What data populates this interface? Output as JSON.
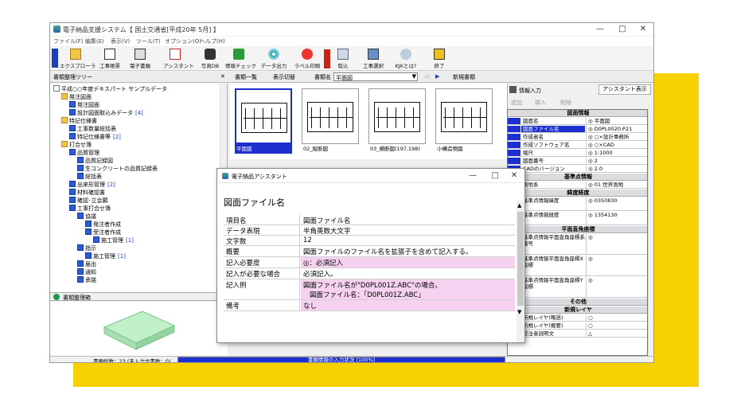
{
  "colors": {
    "accent": "#1c2fcf",
    "highlight": "#f7d1f0",
    "banner": "#f7d100"
  },
  "window": {
    "title": "電子納品支援システム【 国土交通省[平成20年 5月] 】",
    "minimize": "—",
    "maximize": "□",
    "close": "✕"
  },
  "menu": [
    "ファイル(F)",
    "編集(E)",
    "表示(V)",
    "ツール(T)",
    "オプション(O)",
    "ヘルプ(H)"
  ],
  "toolbar": [
    {
      "label": "エクスプローラ",
      "icon": "explorer-icon"
    },
    {
      "label": "工事帳票",
      "icon": "form-icon"
    },
    {
      "label": "電子書類",
      "icon": "document-icon"
    },
    {
      "label": "アシスタント",
      "icon": "assistant-icon"
    },
    {
      "label": "写真DB",
      "icon": "camera-icon"
    },
    {
      "label": "情報チェック",
      "icon": "check-icon"
    },
    {
      "label": "データ出力",
      "icon": "disc-icon"
    },
    {
      "label": "ラベル印刷",
      "icon": "label-icon"
    },
    {
      "label": "取込",
      "icon": "import-icon"
    },
    {
      "label": "工事選択",
      "icon": "select-icon"
    },
    {
      "label": "KJKとは?",
      "icon": "help-icon"
    },
    {
      "label": "終了",
      "icon": "exit-icon"
    }
  ],
  "tree_panel": {
    "title": "書類整理ツリー",
    "close": "✕"
  },
  "tree": [
    {
      "label": "平成○○年度デキスパート サンプルデータ",
      "level": 0,
      "type": "root"
    },
    {
      "label": "発注図面",
      "level": 1,
      "type": "folder"
    },
    {
      "label": "発注図面",
      "level": 2,
      "type": "doc"
    },
    {
      "label": "設計図面取込みデータ",
      "count": "[4]",
      "level": 2,
      "type": "doc"
    },
    {
      "label": "特記仕様書",
      "level": 1,
      "type": "folder"
    },
    {
      "label": "工事数量総括表",
      "level": 2,
      "type": "doc"
    },
    {
      "label": "特記仕様書等",
      "count": "[2]",
      "level": 2,
      "type": "doc"
    },
    {
      "label": "打合せ簿",
      "level": 1,
      "type": "folder"
    },
    {
      "label": "品質管理",
      "level": 2,
      "type": "doc"
    },
    {
      "label": "品質記録図",
      "level": 3,
      "type": "doc"
    },
    {
      "label": "生コンクリートの品質記録表",
      "level": 3,
      "type": "doc"
    },
    {
      "label": "総括表",
      "level": 3,
      "type": "doc"
    },
    {
      "label": "出来形管理",
      "count": "[2]",
      "level": 2,
      "type": "doc"
    },
    {
      "label": "材料確認書",
      "level": 2,
      "type": "doc"
    },
    {
      "label": "確認･立会願",
      "level": 2,
      "type": "doc"
    },
    {
      "label": "工事打合せ簿",
      "level": 2,
      "type": "doc"
    },
    {
      "label": "協議",
      "level": 3,
      "type": "doc"
    },
    {
      "label": "発注者作成",
      "level": 4,
      "type": "doc"
    },
    {
      "label": "受注者作成",
      "level": 4,
      "type": "doc"
    },
    {
      "label": "施工管理",
      "count": "[1]",
      "level": 5,
      "type": "doc"
    },
    {
      "label": "指示",
      "level": 3,
      "type": "doc"
    },
    {
      "label": "施工管理",
      "count": "[1]",
      "level": 4,
      "type": "doc"
    },
    {
      "label": "届出",
      "level": 3,
      "type": "doc"
    },
    {
      "label": "通知",
      "level": 3,
      "type": "doc"
    },
    {
      "label": "承諾",
      "level": 3,
      "type": "doc"
    }
  ],
  "box_panel": {
    "title": "書類整理箱"
  },
  "subtoolbar": {
    "list": "書類一覧",
    "view_switch": "表示切替",
    "doc_name_label": "書類名",
    "doc_name_value": "平面図",
    "new_doc": "新規書類"
  },
  "thumbnails": [
    {
      "caption": "平面図",
      "selected": true
    },
    {
      "caption": "02_縦断図",
      "selected": false
    },
    {
      "caption": "03_横断図(197,198)",
      "selected": false
    },
    {
      "caption": "小構造物図",
      "selected": false
    }
  ],
  "info_panel": {
    "title": "情報入力",
    "assistant_button": "アシスタント表示",
    "btn_add": "追加",
    "btn_insert": "挿入",
    "btn_delete": "削除"
  },
  "info_rows": [
    {
      "type": "head",
      "label": "図面情報"
    },
    {
      "name": "図面名",
      "value": "◎ 平面図"
    },
    {
      "name": "図面ファイル名",
      "value": "◎ D0PL0020.P21",
      "selected": true
    },
    {
      "name": "作成者名",
      "value": "◎ ○×設計事務所"
    },
    {
      "name": "作成ソフトウェア名",
      "value": "◎ ○×CAD"
    },
    {
      "name": "縮尺",
      "value": "◎ 1:1000"
    },
    {
      "name": "図面番号",
      "value": "◎ 2"
    },
    {
      "name": "CADのバージョン",
      "value": "◎ 2.0"
    },
    {
      "type": "head",
      "label": "基準点情報"
    },
    {
      "name": "測地系",
      "value": "◎ 01:世界測地"
    },
    {
      "type": "head",
      "label": "緯度経度"
    },
    {
      "name": "基準点情報緯度",
      "value": "◎ 0350830",
      "tall": true
    },
    {
      "name": "基準点情報経度",
      "value": "◎ 1354130",
      "tall": true
    },
    {
      "type": "head",
      "label": "平面直角座標"
    },
    {
      "name": "基準点情報平面直角座標系番号",
      "value": "◎",
      "tall3": true
    },
    {
      "name": "基準点情報平面直角座標X座標",
      "value": "◎",
      "tall3": true
    },
    {
      "name": "基準点情報平面直角座標Y座標",
      "value": "◎",
      "tall3": true
    },
    {
      "type": "head",
      "label": "その他"
    },
    {
      "type": "head",
      "label": "新規レイヤ"
    },
    {
      "name": "新規レイヤ(略語)",
      "value": "○"
    },
    {
      "name": "新規レイヤ(概要)",
      "value": "○"
    },
    {
      "name": "受注者説明文",
      "value": "△"
    }
  ],
  "status": {
    "count": "書類総数：23 (未入力文書数：0)",
    "progress": "書類情報の入力状況 [100%]",
    "progress_value": 1.0
  },
  "dialog": {
    "title": "電子納品アシスタント",
    "minimize": "—",
    "maximize": "□",
    "close": "✕",
    "heading": "図面ファイル名",
    "rows": [
      {
        "label": "項目名",
        "value": "図面ファイル名"
      },
      {
        "label": "データ表現",
        "value": "半角英数大文字"
      },
      {
        "label": "文字数",
        "value": "12"
      },
      {
        "label": "概要",
        "value": "図面ファイルのファイル名を拡張子を含めて記入する。"
      },
      {
        "label": "記入必要度",
        "value": "◎：必須記入",
        "pink": true
      },
      {
        "label": "記入が必要な場合",
        "value": "必須記入。"
      },
      {
        "label": "記入例",
        "value": "図面ファイル名が\"D0PL001Z.ABC\"の場合。",
        "value2": "図面ファイル名：「D0PL001Z.ABC」",
        "pink": true
      },
      {
        "label": "備考",
        "value": "なし",
        "pink": true
      }
    ]
  }
}
